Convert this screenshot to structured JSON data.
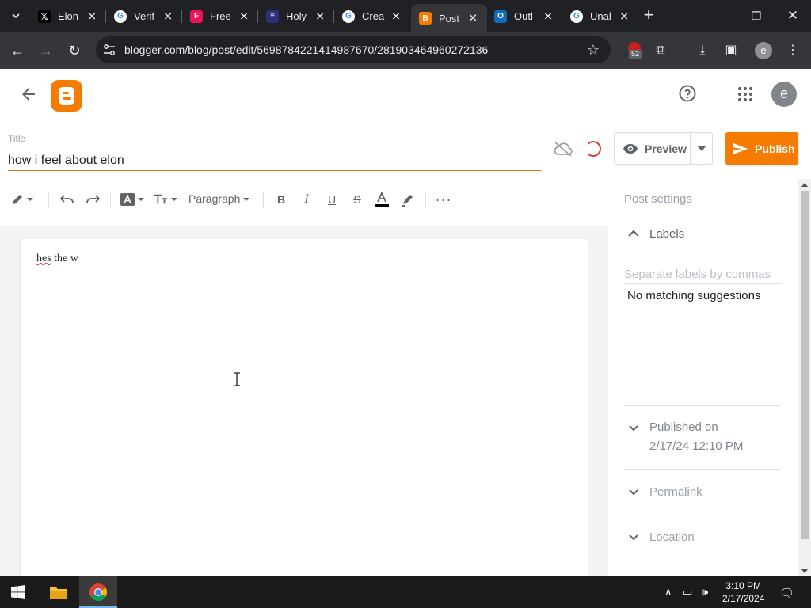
{
  "browser": {
    "tabs": [
      {
        "title": "Elon",
        "icon": "x-logo-icon",
        "color": "#000000"
      },
      {
        "title": "Verif",
        "icon": "google-icon",
        "color": "#4285f4"
      },
      {
        "title": "Free",
        "icon": "freepik-icon",
        "color": "#e8155a"
      },
      {
        "title": "Holy",
        "icon": "holy-icon",
        "color": "#3b3bb3"
      },
      {
        "title": "Crea",
        "icon": "google-icon",
        "color": "#4285f4"
      },
      {
        "title": "Post",
        "icon": "blogger-icon",
        "color": "#f57c00",
        "active": true
      },
      {
        "title": "Outl",
        "icon": "outlook-icon",
        "color": "#0f6cbd"
      },
      {
        "title": "Unal",
        "icon": "google-icon",
        "color": "#4285f4"
      }
    ],
    "url": "blogger.com/blog/post/edit/5698784221414987670/2819034649602721​36",
    "extension_badge": "52",
    "profile_initial": "e"
  },
  "app": {
    "avatar_initial": "e",
    "brand_color": "#f57c00"
  },
  "post": {
    "title_label": "Title",
    "title_value": "how i feel about elon",
    "body_word1": "hes",
    "body_rest": " the w"
  },
  "actions": {
    "preview_label": "Preview",
    "publish_label": "Publish"
  },
  "toolbar": {
    "paragraph_label": "Paragraph"
  },
  "sidebar": {
    "heading": "Post settings",
    "labels_title": "Labels",
    "labels_placeholder": "Separate labels by commas",
    "no_match": "No matching suggestions",
    "published_line1": "Published on",
    "published_line2": "2/17/24 12:10 PM",
    "permalink": "Permalink",
    "location": "Location"
  },
  "taskbar": {
    "time": "3:10 PM",
    "date": "2/17/2024"
  }
}
